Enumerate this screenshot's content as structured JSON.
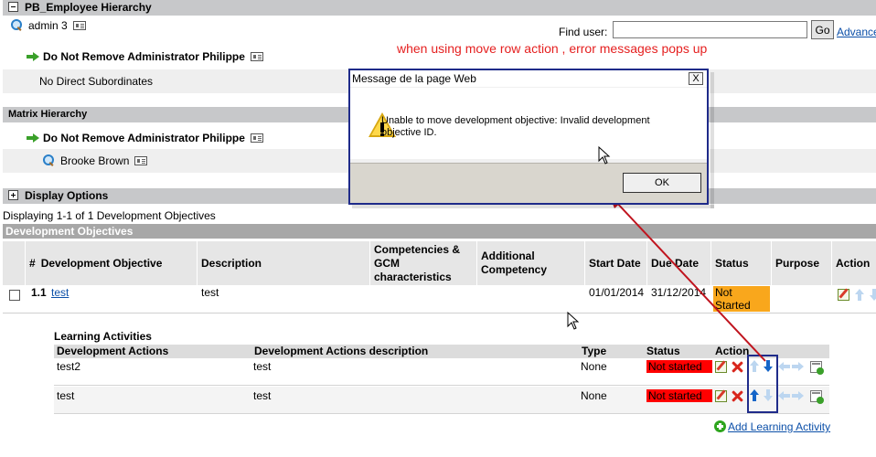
{
  "employee_hierarchy": {
    "title": "PB_Employee Hierarchy",
    "current_user": "admin 3",
    "manager": "Do Not Remove Administrator Philippe",
    "no_subordinates": "No Direct Subordinates",
    "find_user_label": "Find user:",
    "find_user_value": "",
    "go_label": "Go",
    "advanced_link": "Advance"
  },
  "annotation": "when using move row action , error messages pops up",
  "matrix_hierarchy": {
    "title": "Matrix Hierarchy",
    "manager": "Do Not Remove Administrator Philippe",
    "member": "Brooke Brown"
  },
  "display_options": {
    "title": "Display Options"
  },
  "paging": "Displaying 1-1 of 1 Development Objectives",
  "objectives": {
    "title": "Development Objectives",
    "columns": {
      "num": "#",
      "objective": "Development Objective",
      "description": "Description",
      "competencies": "Competencies & GCM characteristics",
      "additional": "Additional Competency",
      "start": "Start Date",
      "due": "Due Date",
      "status": "Status",
      "purpose": "Purpose",
      "action": "Action"
    },
    "row": {
      "num": "1.1",
      "objective": "test",
      "description": "test",
      "start": "01/01/2014",
      "due": "31/12/2014",
      "status": "Not Started"
    }
  },
  "learning": {
    "title": "Learning Activities",
    "columns": {
      "actions": "Development Actions",
      "desc": "Development Actions description",
      "type": "Type",
      "status": "Status",
      "action": "Action"
    },
    "rows": [
      {
        "action": "test2",
        "desc": "test",
        "type": "None",
        "status": "Not started"
      },
      {
        "action": "test",
        "desc": "test",
        "type": "None",
        "status": "Not started"
      }
    ],
    "add_link": "Add Learning Activity"
  },
  "dialog": {
    "title": "Message de la page Web",
    "close": "X",
    "message": "Unable to move development objective: Invalid development objective ID.",
    "ok": "OK"
  },
  "colors": {
    "header_gray": "#c7c8ca",
    "status_orange": "#f9a71c",
    "status_red": "#ff0000",
    "annotation_red": "#e52020",
    "highlight_navy": "#1f2b8a"
  }
}
